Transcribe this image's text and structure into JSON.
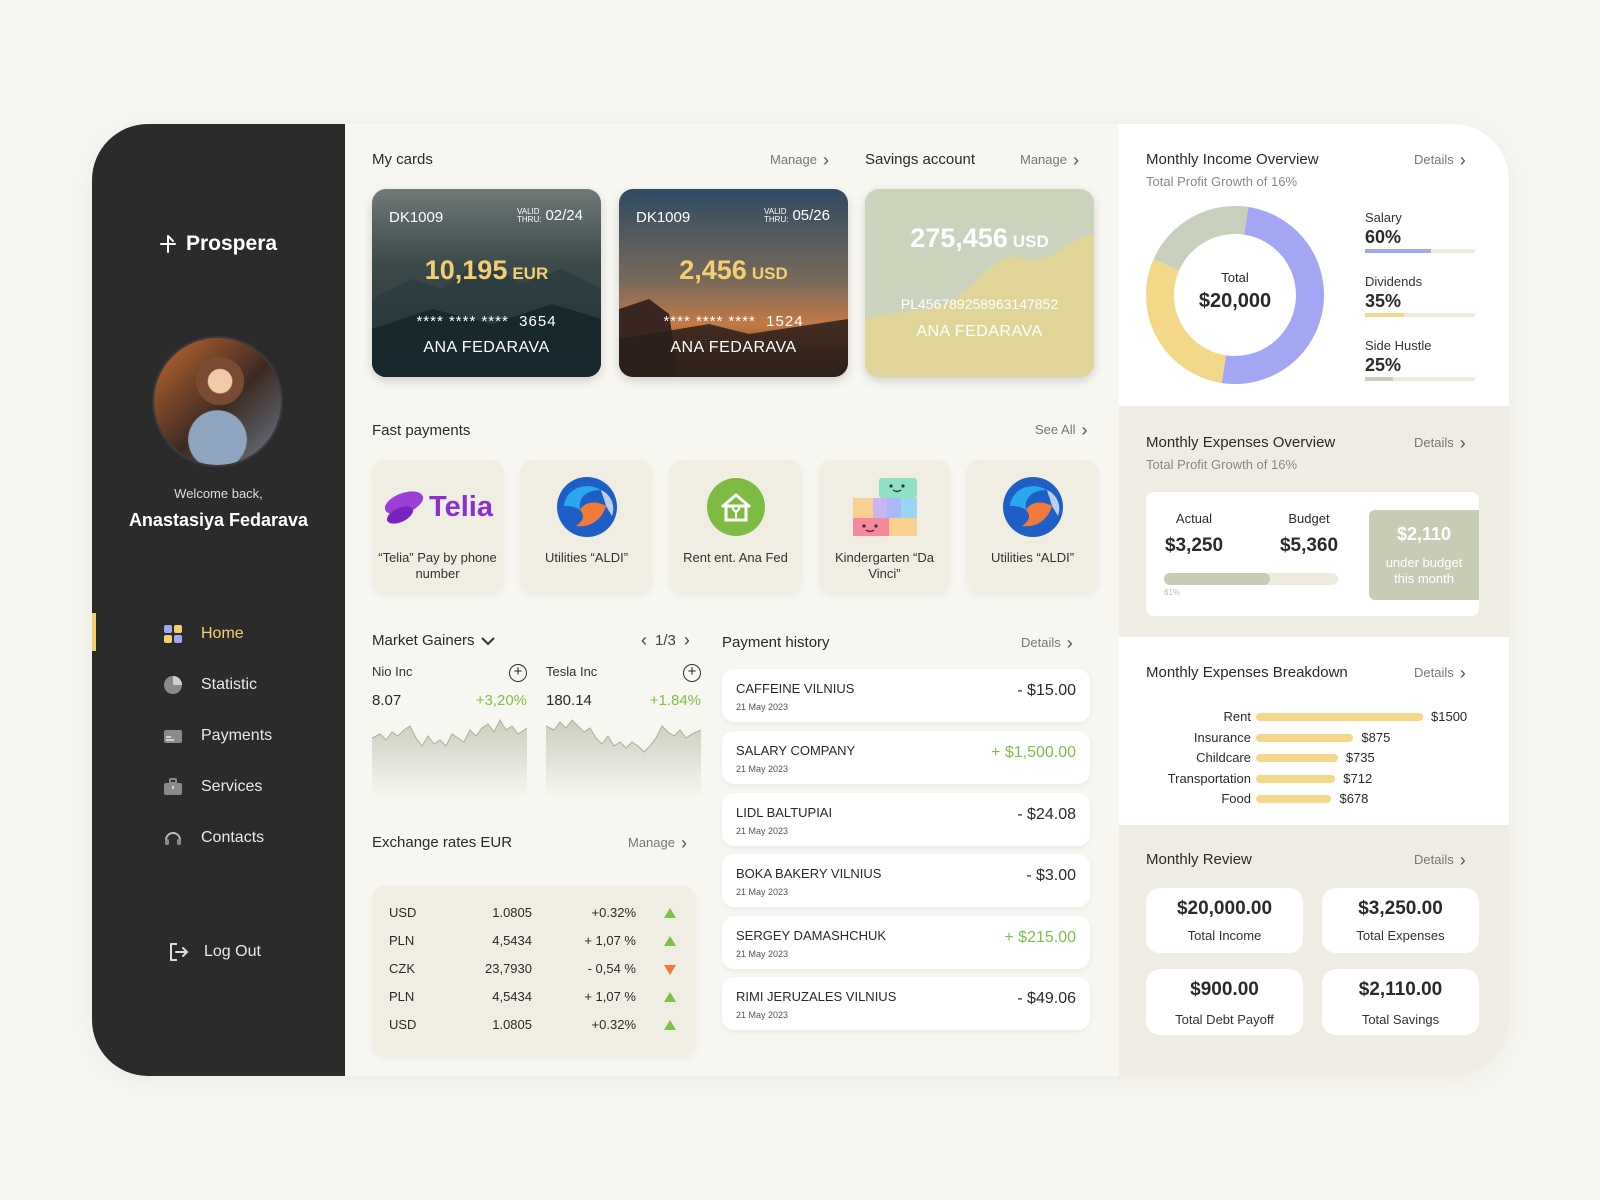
{
  "brand": {
    "name": "Prospera"
  },
  "user": {
    "welcome": "Welcome back,",
    "name": "Anastasiya Fedarava"
  },
  "nav": [
    {
      "label": "Home",
      "icon": "grid-icon",
      "active": true
    },
    {
      "label": "Statistic",
      "icon": "pie-icon"
    },
    {
      "label": "Payments",
      "icon": "card-icon"
    },
    {
      "label": "Services",
      "icon": "briefcase-icon"
    },
    {
      "label": "Contacts",
      "icon": "headset-icon"
    }
  ],
  "logout": "Log Out",
  "my_cards": {
    "title": "My cards",
    "manage": "Manage",
    "cards": [
      {
        "number": "DK1009",
        "valid_label_1": "VALID",
        "valid_label_2": "THRU:",
        "valid": "02/24",
        "balance": "10,195",
        "currency": "EUR",
        "pan_mask": "**** **** ****",
        "pan_last": "3654",
        "holder": "ANA FEDARAVA"
      },
      {
        "number": "DK1009",
        "valid_label_1": "VALID",
        "valid_label_2": "THRU:",
        "valid": "05/26",
        "balance": "2,456",
        "currency": "USD",
        "pan_mask": "**** **** ****",
        "pan_last": "1524",
        "holder": "ANA FEDARAVA"
      }
    ]
  },
  "savings": {
    "title": "Savings account",
    "manage": "Manage",
    "balance": "275,456",
    "currency": "USD",
    "iban": "PL45678925896314 7852",
    "iban_display": "PL456789258963147852",
    "holder": "ANA FEDARAVA"
  },
  "fast_payments": {
    "title": "Fast payments",
    "see_all": "See All",
    "items": [
      {
        "label": "“Telia” Pay by phone number",
        "logo_text": "Telia"
      },
      {
        "label": "Utilities “ALDI”"
      },
      {
        "label": "Rent ent. Ana Fed"
      },
      {
        "label": "Kindergarten “Da Vinci”"
      },
      {
        "label": "Utilities “ALDI”"
      }
    ]
  },
  "market": {
    "title": "Market Gainers",
    "pager": "1/3",
    "items": [
      {
        "name": "Nio Inc",
        "price": "8.07",
        "change": "+3,20%"
      },
      {
        "name": "Tesla Inc",
        "price": "180.14",
        "change": "+1.84%"
      }
    ]
  },
  "exchange": {
    "title": "Exchange rates EUR",
    "manage": "Manage",
    "rows": [
      {
        "cur": "USD",
        "rate": "1.0805",
        "chg": "+0.32%",
        "dir": "up"
      },
      {
        "cur": "PLN",
        "rate": "4,5434",
        "chg": "+ 1,07 %",
        "dir": "up"
      },
      {
        "cur": "CZK",
        "rate": "23,7930",
        "chg": "- 0,54 %",
        "dir": "down"
      },
      {
        "cur": "PLN",
        "rate": "4,5434",
        "chg": "+ 1,07 %",
        "dir": "up"
      },
      {
        "cur": "USD",
        "rate": "1.0805",
        "chg": "+0.32%",
        "dir": "up"
      }
    ]
  },
  "history": {
    "title": "Payment history",
    "details": "Details",
    "items": [
      {
        "merchant": "CAFFEINE VILNIUS",
        "date": "21 May 2023",
        "amount": "- $15.00",
        "positive": false
      },
      {
        "merchant": "SALARY COMPANY",
        "date": "21 May 2023",
        "amount": "+ $1,500.00",
        "positive": true
      },
      {
        "merchant": "LIDL BALTUPIAI",
        "date": "21 May 2023",
        "amount": "- $24.08",
        "positive": false
      },
      {
        "merchant": "BOKA BAKERY VILNIUS",
        "date": "21 May 2023",
        "amount": "- $3.00",
        "positive": false
      },
      {
        "merchant": "SERGEY DAMASHCHUK",
        "date": "21 May 2023",
        "amount": "+ $215.00",
        "positive": true
      },
      {
        "merchant": "RIMI JERUZALES VILNIUS",
        "date": "21 May 2023",
        "amount": "- $49.06",
        "positive": false
      }
    ]
  },
  "income": {
    "title": "Monthly Income Overview",
    "details": "Details",
    "subtitle": "Total Profit Growth of 16%",
    "center_label": "Total",
    "center_value": "$20,000",
    "items": [
      {
        "name": "Salary",
        "pct": "60%",
        "value": 0.6,
        "color": "#a3a7f3"
      },
      {
        "name": "Dividends",
        "pct": "35%",
        "value": 0.35,
        "color": "#f3d88a"
      },
      {
        "name": "Side Hustle",
        "pct": "25%",
        "value": 0.25,
        "color": "#c9cfbd"
      }
    ]
  },
  "expenses": {
    "title": "Monthly Expenses Overview",
    "details": "Details",
    "subtitle": "Total Profit Growth of 16%",
    "actual_label": "Actual",
    "actual": "$3,250",
    "budget_label": "Budget",
    "budget": "$5,360",
    "progress_label": "61%",
    "progress": 0.61,
    "under_value": "$2,110",
    "under_label": "under budget this month"
  },
  "breakdown": {
    "title": "Monthly Expenses Breakdown",
    "details": "Details",
    "items": [
      {
        "label": "Rent",
        "value": "$1500",
        "amount": 1500
      },
      {
        "label": "Insurance",
        "value": "$875",
        "amount": 875
      },
      {
        "label": "Childcare",
        "value": "$735",
        "amount": 735
      },
      {
        "label": "Transportation",
        "value": "$712",
        "amount": 712
      },
      {
        "label": "Food",
        "value": "$678",
        "amount": 678
      }
    ]
  },
  "review": {
    "title": "Monthly Review",
    "details": "Details",
    "items": [
      {
        "value": "$20,000.00",
        "label": "Total Income"
      },
      {
        "value": "$3,250.00",
        "label": "Total Expenses"
      },
      {
        "value": "$900.00",
        "label": "Total Debt Payoff"
      },
      {
        "value": "$2,110.00",
        "label": "Total Savings"
      }
    ]
  },
  "colors": {
    "sidebar": "#2b2b2b",
    "accent": "#f3cf6f",
    "positive": "#7fc04a",
    "negative": "#f07a3a",
    "income_ring": [
      "#a3a7f3",
      "#f3d88a",
      "#c9cfbd"
    ]
  }
}
